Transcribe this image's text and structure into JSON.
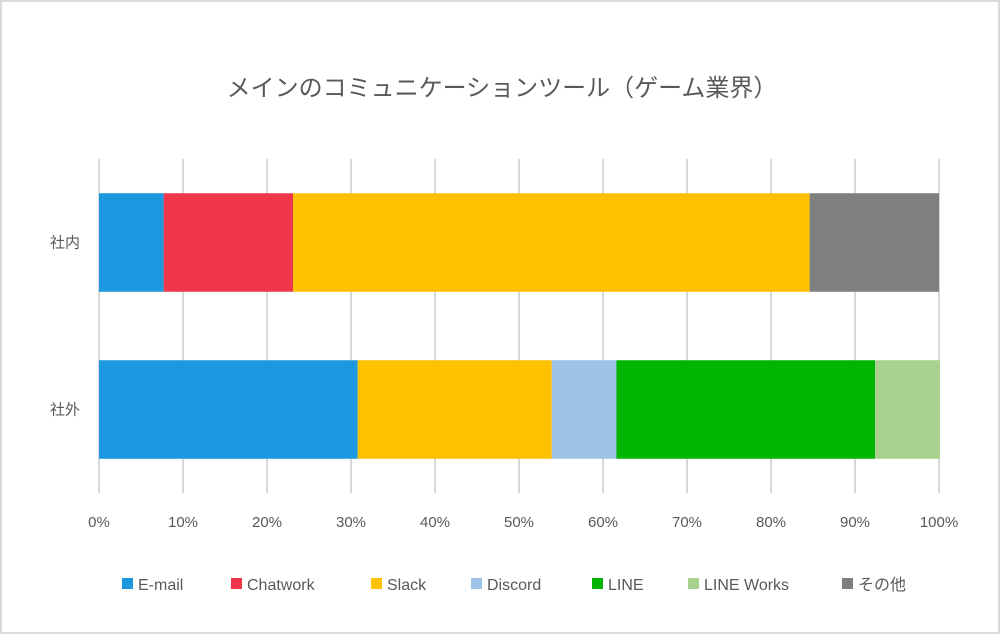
{
  "chart_data": {
    "type": "bar",
    "orientation": "horizontal",
    "stacked": "percent",
    "title": "メインのコミュニケーションツール（ゲーム業界）",
    "xlabel": "",
    "ylabel": "",
    "xlim": [
      0,
      100
    ],
    "x_ticks": [
      "0%",
      "10%",
      "20%",
      "30%",
      "40%",
      "50%",
      "60%",
      "70%",
      "80%",
      "90%",
      "100%"
    ],
    "grid": true,
    "legend_position": "bottom",
    "categories": [
      "社内",
      "社外"
    ],
    "series": [
      {
        "name": "E-mail",
        "color": "#1b98e0",
        "values": [
          7.7,
          30.8
        ]
      },
      {
        "name": "Chatwork",
        "color": "#f0364a",
        "values": [
          15.4,
          0
        ]
      },
      {
        "name": "Slack",
        "color": "#ffc000",
        "values": [
          61.5,
          23.1
        ]
      },
      {
        "name": "Discord",
        "color": "#9dc3e6",
        "values": [
          0,
          7.7
        ]
      },
      {
        "name": "LINE",
        "color": "#00b400",
        "values": [
          0,
          30.8
        ]
      },
      {
        "name": "LINE Works",
        "color": "#a9d18e",
        "values": [
          0,
          7.7
        ]
      },
      {
        "name": "その他",
        "color": "#7f7f7f",
        "values": [
          15.4,
          0
        ]
      }
    ]
  }
}
